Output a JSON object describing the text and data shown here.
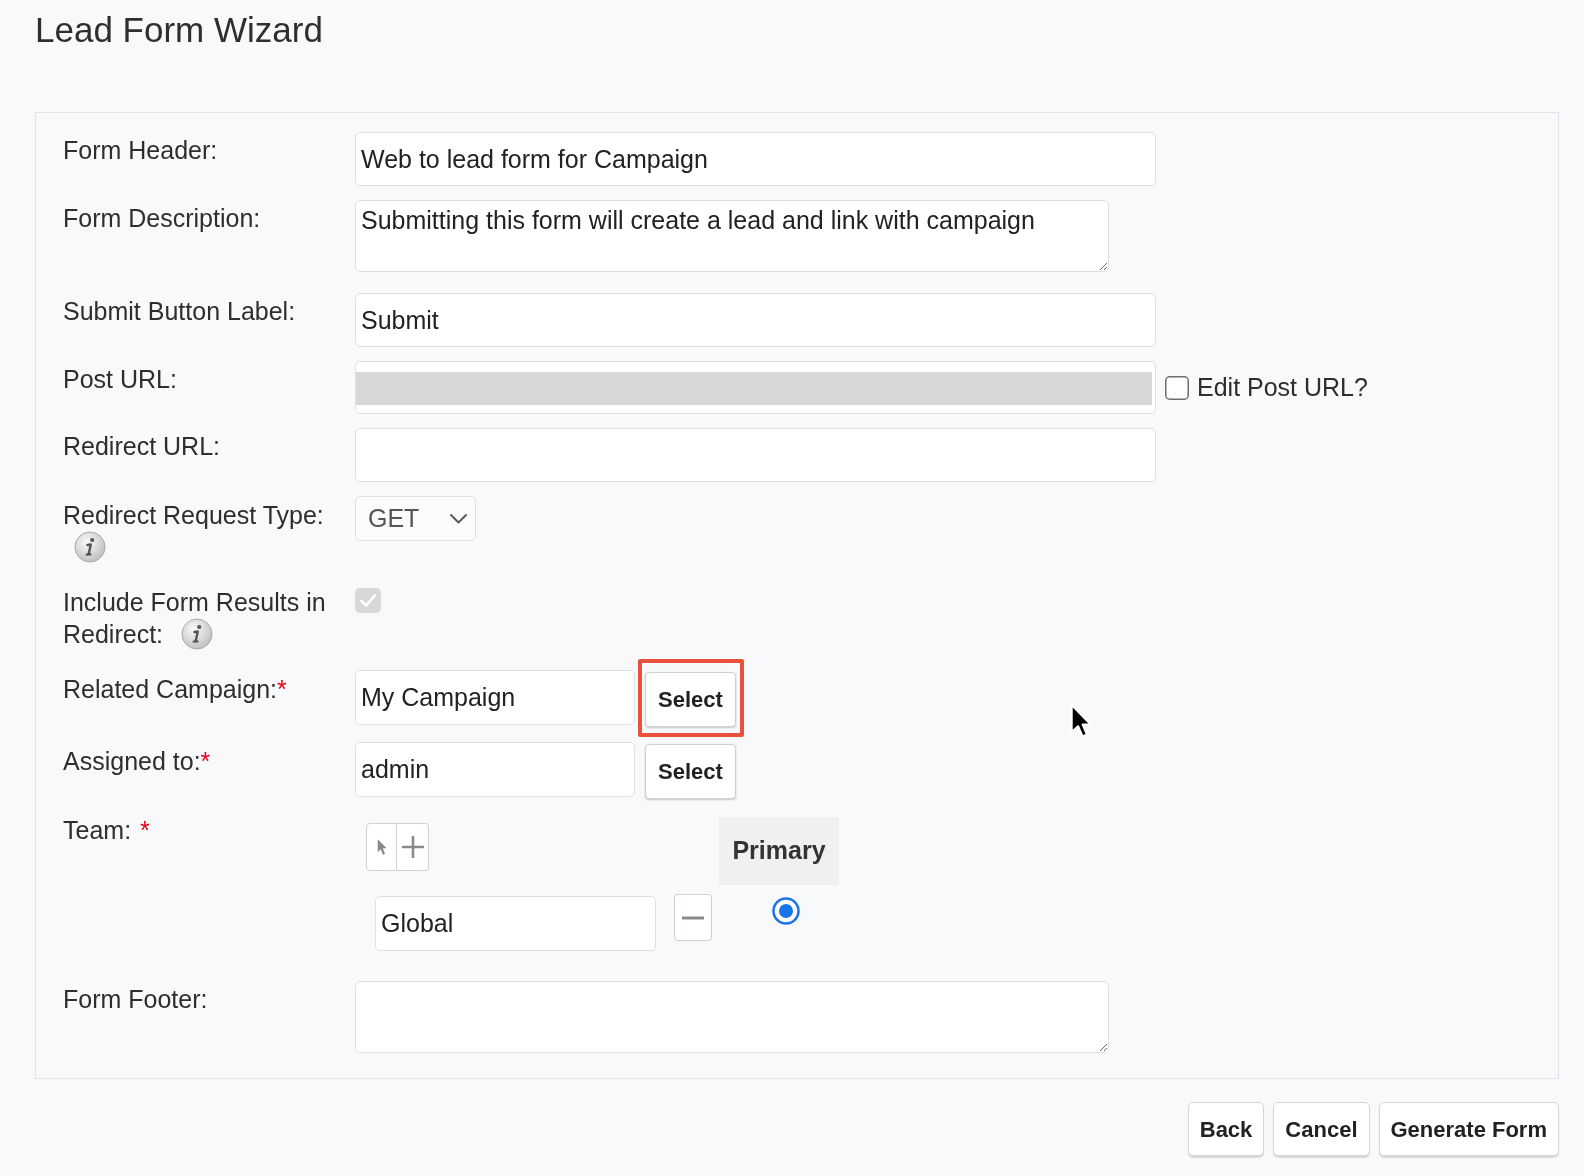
{
  "page_title": "Lead Form Wizard",
  "form": {
    "rows": [
      {
        "kind": "text",
        "label": "Form Header:",
        "value": "Web to lead form for Campaign"
      },
      {
        "kind": "textarea",
        "label": "Form Description:",
        "value": "Submitting this form will create a lead and link with campaign"
      },
      {
        "kind": "text",
        "label": "Submit Button Label:",
        "value": "Submit"
      },
      {
        "kind": "url_toggle",
        "label": "Post URL:",
        "disabled": true,
        "toggle": {
          "label": "Edit Post URL?",
          "checked": false
        }
      },
      {
        "kind": "text",
        "label": "Redirect URL:"
      },
      {
        "kind": "select",
        "label": "Redirect Request Type:",
        "info": true,
        "value": "GET"
      },
      {
        "kind": "checkbox",
        "label_lines": [
          "Include Form Results in",
          "Redirect:"
        ],
        "info": true,
        "checked": true,
        "disabled": true
      },
      {
        "kind": "relate",
        "label": "Related Campaign:",
        "required_mark": "*",
        "value": "My Campaign",
        "button": {
          "label": "Select",
          "highlighted": true
        }
      },
      {
        "kind": "relate",
        "label": "Assigned to:",
        "required_mark": "*",
        "value": "admin",
        "button": {
          "label": "Select",
          "highlighted": false
        }
      },
      {
        "kind": "team",
        "label": "Team:",
        "required_mark": "*",
        "primary_header": "Primary",
        "teams": [
          {
            "name": "Global",
            "selected": true
          }
        ]
      },
      {
        "kind": "textarea",
        "label": "Form Footer:"
      }
    ]
  },
  "buttons": [
    {
      "label": "Back"
    },
    {
      "label": "Cancel"
    },
    {
      "label": "Generate Form"
    }
  ]
}
